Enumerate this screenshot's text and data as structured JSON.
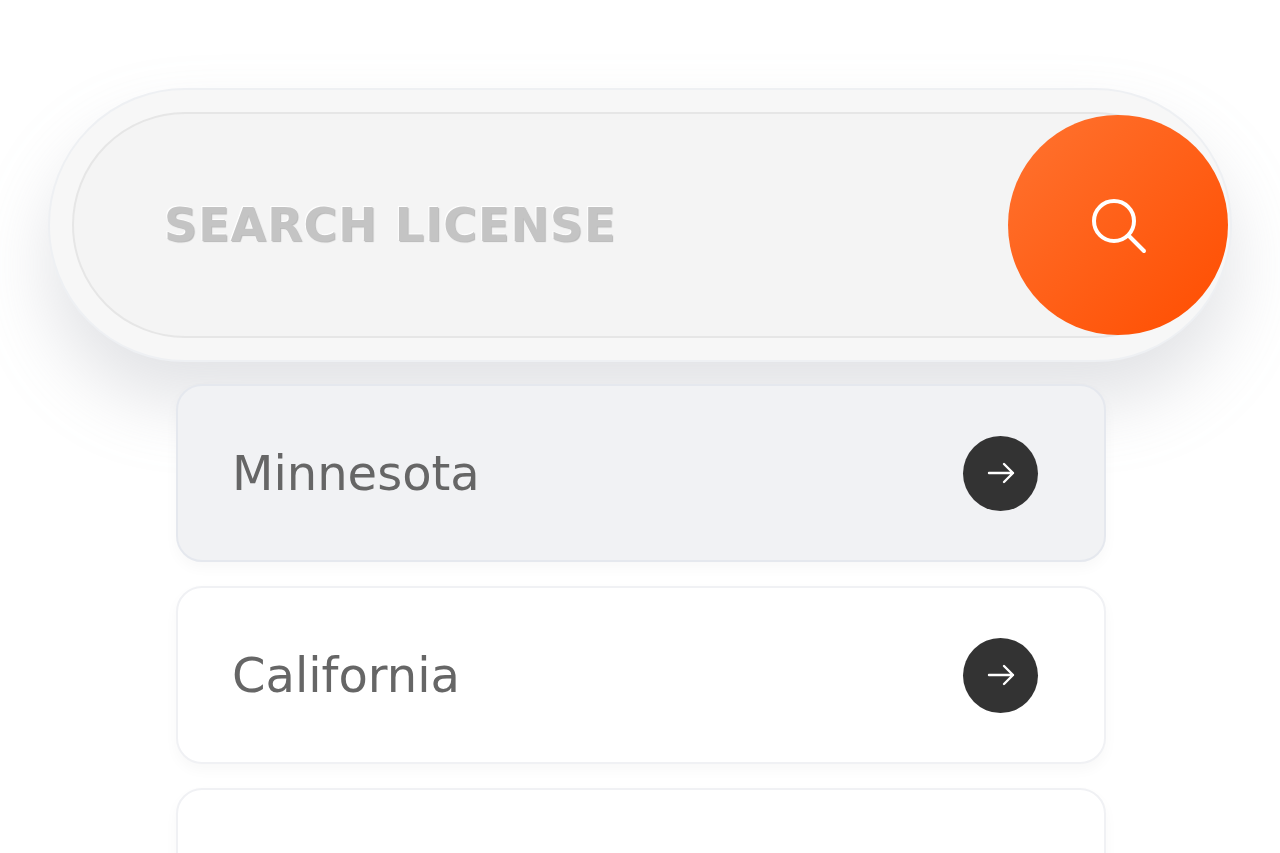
{
  "search": {
    "placeholder": "SEARCH LICENSE"
  },
  "results": [
    {
      "label": "Minnesota",
      "selected": true
    },
    {
      "label": "California",
      "selected": false
    },
    {
      "selected": false
    }
  ]
}
